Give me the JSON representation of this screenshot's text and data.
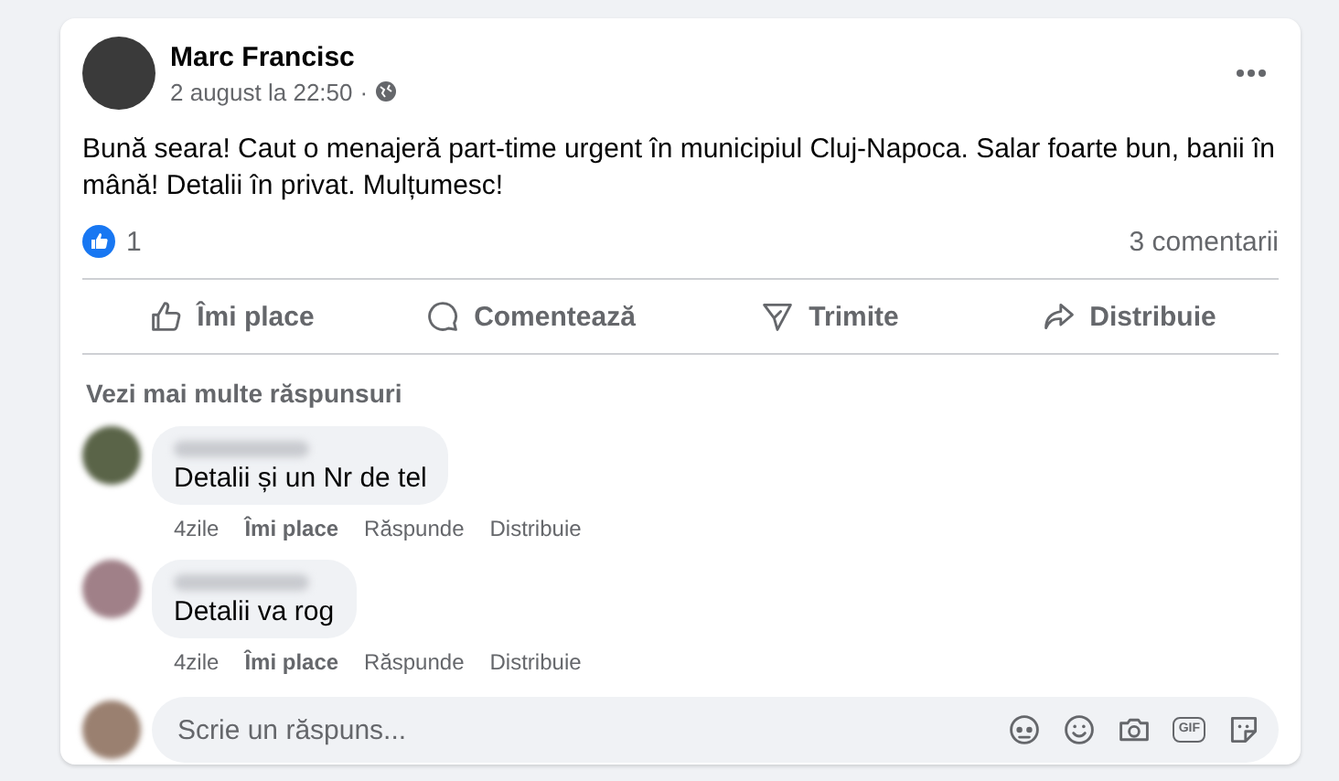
{
  "post": {
    "author": "Marc Francisc",
    "time": "2 august la 22:50",
    "separator": "·",
    "text": "Bună seara! Caut o menajeră part-time urgent în municipiul Cluj-Napoca. Salar foarte bun, banii în mână! Detalii în privat. Mulțumesc!",
    "reactions": "1",
    "comments_count": "3 comentarii"
  },
  "actions": [
    {
      "kind": "like",
      "label": "Îmi place"
    },
    {
      "kind": "comment",
      "label": "Comentează"
    },
    {
      "kind": "send",
      "label": "Trimite"
    },
    {
      "kind": "share",
      "label": "Distribuie"
    }
  ],
  "more_replies": "Vezi mai multe răspunsuri",
  "comments": [
    {
      "text": "Detalii și un Nr de tel",
      "time": "4zile",
      "like": "Îmi place",
      "reply": "Răspunde",
      "share": "Distribuie"
    },
    {
      "text": "Detalii va rog",
      "time": "4zile",
      "like": "Îmi place",
      "reply": "Răspunde",
      "share": "Distribuie"
    }
  ],
  "composer": {
    "placeholder": "Scrie un răspuns...",
    "gif_label": "GIF"
  }
}
